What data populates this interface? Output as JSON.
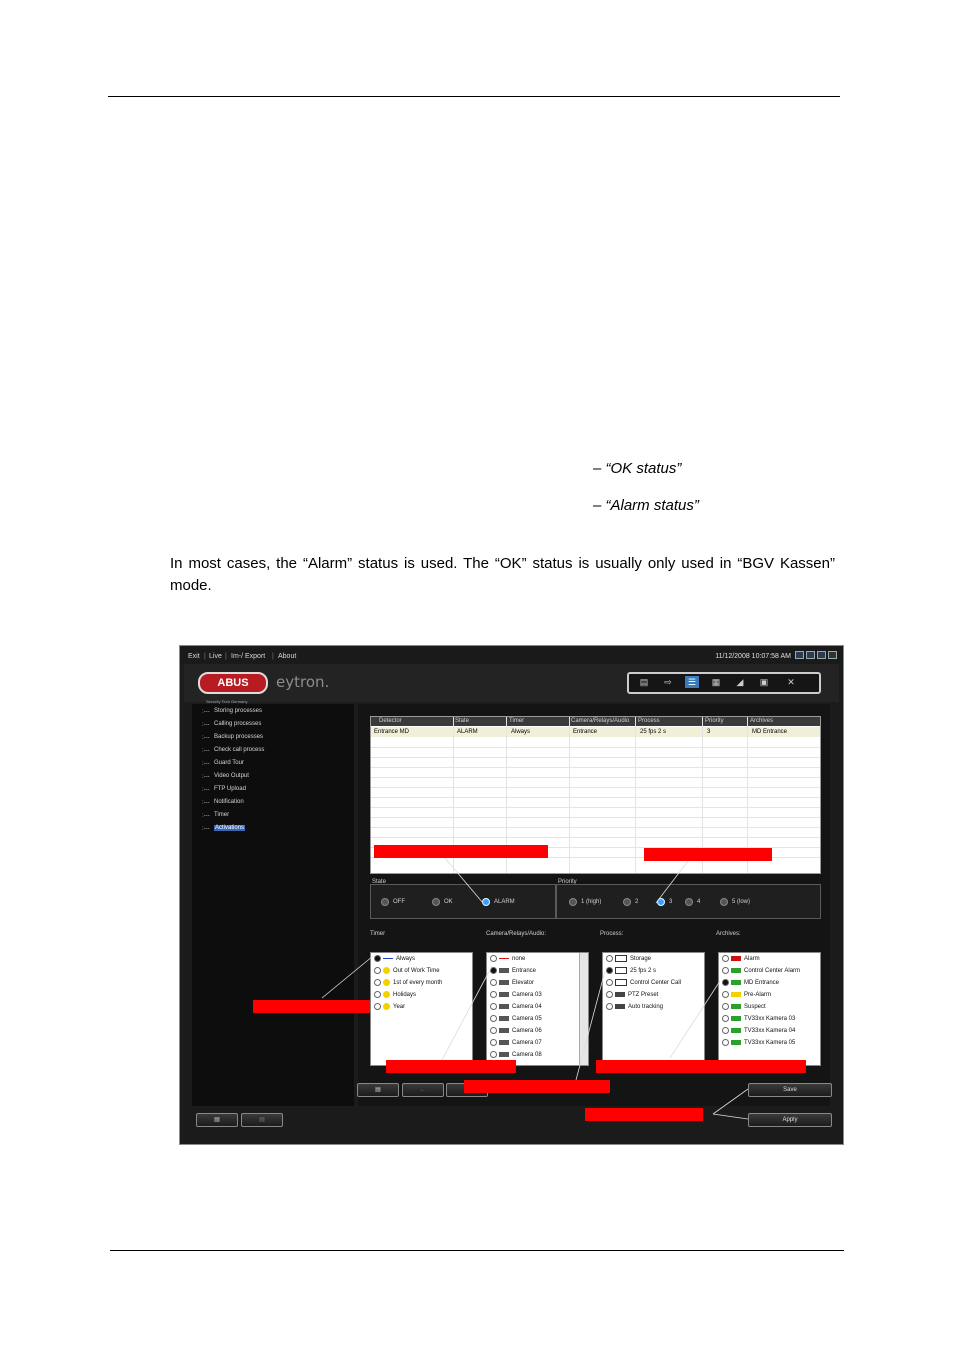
{
  "document": {
    "line_ok": "– “OK status”",
    "line_alarm": "– “Alarm status”",
    "paragraph": "In most cases, the “Alarm” status is used. The “OK” status is usually only used in “BGV Kassen” mode."
  },
  "app": {
    "menu": [
      "Exit",
      "Live",
      "Im-/ Export",
      "About"
    ],
    "datetime": "11/12/2008 10:07:58 AM",
    "logo_text": "ABUS",
    "logo_subtitle": "Security Tech Germany",
    "brand": "eytron.",
    "sidebar_items": [
      {
        "label": "Storing processes",
        "selected": false
      },
      {
        "label": "Calling processes",
        "selected": false
      },
      {
        "label": "Backup processes",
        "selected": false
      },
      {
        "label": "Check call process",
        "selected": false
      },
      {
        "label": "Guard Tour",
        "selected": false
      },
      {
        "label": "Video Output",
        "selected": false
      },
      {
        "label": "FTP Upload",
        "selected": false
      },
      {
        "label": "Notification",
        "selected": false
      },
      {
        "label": "Timer",
        "selected": false
      },
      {
        "label": "Activations",
        "selected": true
      }
    ],
    "grid": {
      "columns": [
        "Detector",
        "State",
        "Timer",
        "Camera/Relays/Audio",
        "Process",
        "Priority",
        "Archives"
      ],
      "row": [
        "Entrance MD",
        "ALARM",
        "Always",
        "Entrance",
        "25 fps 2 s",
        "3",
        "MD Entrance"
      ]
    },
    "state": {
      "label": "State",
      "options": [
        "OFF",
        "OK",
        "ALARM"
      ],
      "selected": "ALARM"
    },
    "priority": {
      "label": "Priority",
      "options": [
        "1 (high)",
        "2",
        "3",
        "4",
        "5 (low)"
      ],
      "selected": "3"
    },
    "timer": {
      "title": "Timer",
      "items": [
        "Always",
        "Out of Work Time",
        "1st of every month",
        "Holidays",
        "Year"
      ],
      "selected": "Always"
    },
    "camera": {
      "title": "Camera/Relays/Audio:",
      "items": [
        "none",
        "Entrance",
        "Elevator",
        "Camera 03",
        "Camera 04",
        "Camera 05",
        "Camera 06",
        "Camera 07",
        "Camera 08"
      ],
      "selected": "Entrance"
    },
    "process": {
      "title": "Process:",
      "items": [
        "Storage",
        "25 fps 2 s",
        "Control Center Call",
        "PTZ Preset",
        "Auto tracking"
      ],
      "selected": "25 fps 2 s"
    },
    "archives": {
      "title": "Archives:",
      "items": [
        "Alarm",
        "Control Center Alarm",
        "MD Entrance",
        "Pre-Alarm",
        "Suspect",
        "TV33xx Kamera 03",
        "TV33xx Kamera 04",
        "TV33xx Kamera 05"
      ],
      "selected": "MD Entrance"
    },
    "buttons": {
      "save": "Save",
      "apply": "Apply"
    }
  },
  "colors": {
    "callout_red": "#ff0000",
    "selection_blue": "#3b66b8",
    "logo_red": "#b81c22"
  }
}
